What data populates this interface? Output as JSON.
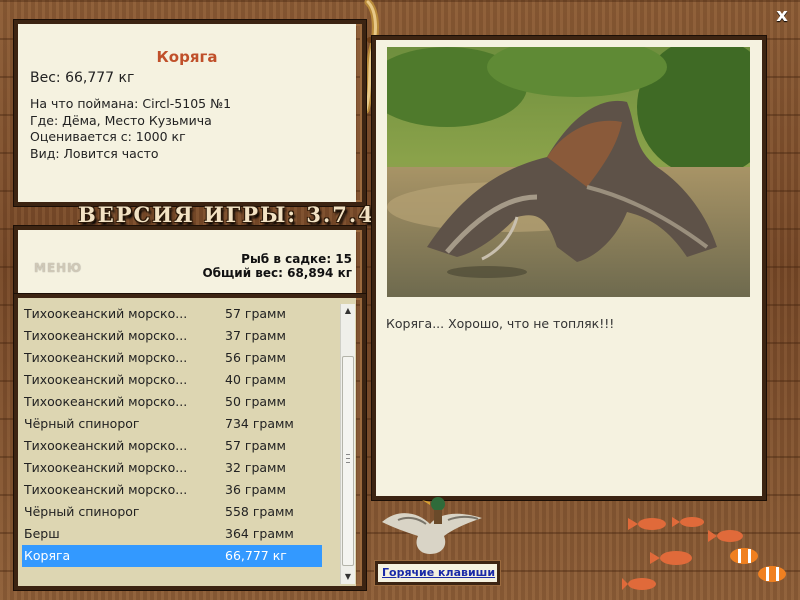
{
  "window": {
    "close_glyph": "x"
  },
  "catch": {
    "name": "Коряга",
    "weight": "Вес: 66,777 кг",
    "lines": [
      "На что поймана: Circl-5105 №1",
      "Где: Дёма, Место Кузьмича",
      "Оценивается с: 1000 кг",
      "Вид: Ловится часто"
    ]
  },
  "version": "ВЕРСИЯ ИГРЫ: 3.7.4",
  "menu_label": "МЕНЮ",
  "stats": {
    "fish_count": "Рыб в садке: 15",
    "total_weight": "Общий вес: 68,894 кг"
  },
  "fish_list": [
    {
      "name": "Тихоокеанский морско...",
      "weight": "57 грамм"
    },
    {
      "name": "Тихоокеанский морско...",
      "weight": "37 грамм"
    },
    {
      "name": "Тихоокеанский морско...",
      "weight": "56 грамм"
    },
    {
      "name": "Тихоокеанский морско...",
      "weight": "40 грамм"
    },
    {
      "name": "Тихоокеанский морско...",
      "weight": "50 грамм"
    },
    {
      "name": "Чёрный спинорог",
      "weight": "734 грамм"
    },
    {
      "name": "Тихоокеанский морско...",
      "weight": "57 грамм"
    },
    {
      "name": "Тихоокеанский морско...",
      "weight": "32 грамм"
    },
    {
      "name": "Тихоокеанский морско...",
      "weight": "36 грамм"
    },
    {
      "name": "Чёрный спинорог",
      "weight": "558 грамм"
    },
    {
      "name": "Берш",
      "weight": "364 грамм"
    },
    {
      "name": "Коряга",
      "weight": "66,777 кг",
      "selected": true
    }
  ],
  "caption": "Коряга... Хорошо, что не топляк!!!",
  "hotkeys_label": "Горячие клавиши",
  "colors": {
    "selection": "#3399ff",
    "panel": "#f5f2e0",
    "title": "#c0502a",
    "wood": "#7a4a28"
  }
}
